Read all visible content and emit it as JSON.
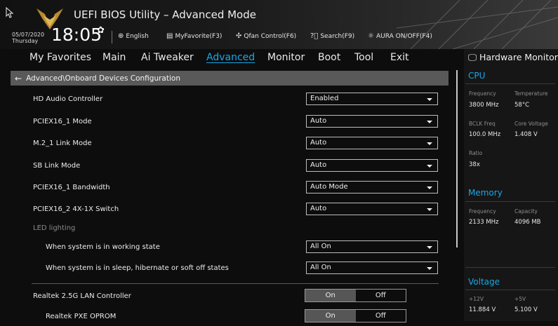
{
  "header": {
    "title": "UEFI BIOS Utility – Advanced Mode",
    "date": "05/07/2020",
    "day": "Thursday",
    "time": "18:05",
    "buttons": {
      "language": "English",
      "my_favorite": "MyFavorite(F3)",
      "qfan": "Qfan Control(F6)",
      "search": "Search(F9)",
      "aura": "AURA ON/OFF(F4)"
    }
  },
  "tabs": [
    "My Favorites",
    "Main",
    "Ai Tweaker",
    "Advanced",
    "Monitor",
    "Boot",
    "Tool",
    "Exit"
  ],
  "active_tab": "Advanced",
  "breadcrumb": "Advanced\\Onboard Devices Configuration",
  "settings": [
    {
      "label": "HD Audio Controller",
      "value": "Enabled"
    },
    {
      "label": "PCIEX16_1 Mode",
      "value": "Auto"
    },
    {
      "label": "M.2_1 Link Mode",
      "value": "Auto"
    },
    {
      "label": "SB Link Mode",
      "value": "Auto"
    },
    {
      "label": "PCIEX16_1 Bandwidth",
      "value": "Auto Mode"
    },
    {
      "label": "PCIEX16_2 4X-1X Switch",
      "value": "Auto"
    },
    {
      "label": "LED lighting"
    },
    {
      "label": "When system is in working state",
      "value": "All On"
    },
    {
      "label": "When system is in sleep, hibernate or soft off states",
      "value": "All On"
    },
    {
      "label": "Realtek 2.5G LAN Controller",
      "on": "On",
      "off": "Off",
      "selected": "On"
    },
    {
      "label": "Realtek PXE OPROM",
      "on": "On",
      "off": "Off",
      "selected": "On"
    }
  ],
  "hardware_monitor": {
    "title": "Hardware Monitor",
    "cpu": {
      "heading": "CPU",
      "frequency_label": "Frequency",
      "frequency": "3800 MHz",
      "temperature_label": "Temperature",
      "temperature": "58°C",
      "bclk_label": "BCLK Freq",
      "bclk": "100.0 MHz",
      "core_voltage_label": "Core Voltage",
      "core_voltage": "1.408 V",
      "ratio_label": "Ratio",
      "ratio": "38x"
    },
    "memory": {
      "heading": "Memory",
      "frequency_label": "Frequency",
      "frequency": "2133 MHz",
      "capacity_label": "Capacity",
      "capacity": "4096 MB"
    },
    "voltage": {
      "heading": "Voltage",
      "v12_label": "+12V",
      "v12": "11.884 V",
      "v5_label": "+5V",
      "v5": "5.100 V"
    }
  },
  "colors": {
    "accent": "#18a8e6",
    "background": "#0d0d0e",
    "breadcrumb_bar": "#595959"
  }
}
